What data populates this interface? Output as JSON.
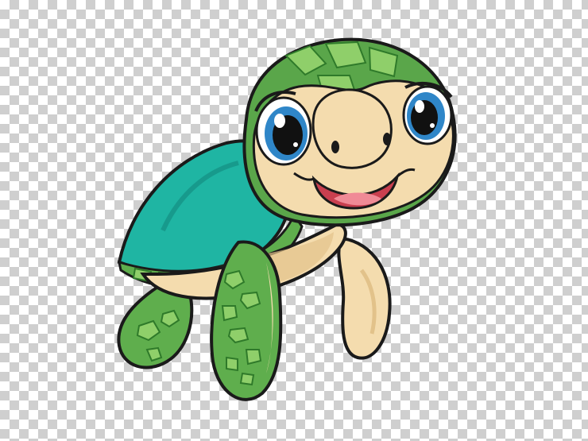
{
  "image": {
    "subject": "cartoon-baby-turtle",
    "background": "transparency-checkerboard"
  },
  "colors": {
    "checker_light": "#ffffff",
    "checker_dark": "#cfcfcf",
    "outline": "#1a1a1a",
    "skin": "#f4dcae",
    "skin_shade": "#e2c28a",
    "shell_teal": "#1fb5a3",
    "shell_teal_dark": "#12897d",
    "shell_green": "#5fae4d",
    "shell_green_light": "#8fcf6a",
    "head_green": "#5aa64a",
    "eye_blue": "#2f86c8",
    "mouth_red": "#c93f4f",
    "tongue_pink": "#f08a96"
  }
}
